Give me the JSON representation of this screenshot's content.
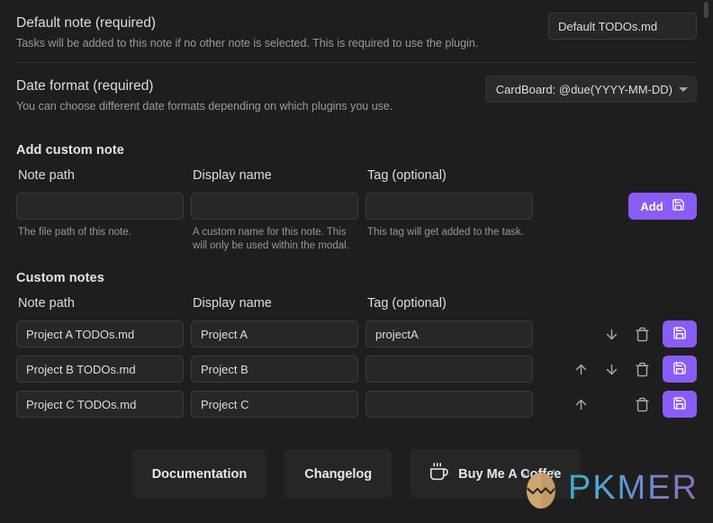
{
  "settings": [
    {
      "name": "Default note (required)",
      "desc": "Tasks will be added to this note if no other note is selected. This is required to use the plugin.",
      "control": "text",
      "value": "Default TODOs.md"
    },
    {
      "name": "Date format (required)",
      "desc": "You can choose different date formats depending on which plugins you use.",
      "control": "select",
      "value": "CardBoard: @due(YYYY-MM-DD)"
    }
  ],
  "add_section": {
    "title": "Add custom note",
    "columns": [
      "Note path",
      "Display name",
      "Tag (optional)"
    ],
    "fields": [
      {
        "value": "",
        "placeholder": "",
        "hint": "The file path of this note."
      },
      {
        "value": "",
        "placeholder": "",
        "hint": "A custom name for this note. This will only be used within the modal."
      },
      {
        "value": "",
        "placeholder": "",
        "hint": "This tag will get added to the task."
      }
    ],
    "add_label": "Add",
    "add_icon": "save-icon"
  },
  "custom_section": {
    "title": "Custom notes",
    "columns": [
      "Note path",
      "Display name",
      "Tag (optional)"
    ],
    "rows": [
      {
        "path": "Project A TODOs.md",
        "display": "Project A",
        "tag": "projectA",
        "has_up": false,
        "has_down": true
      },
      {
        "path": "Project B TODOs.md",
        "display": "Project B",
        "tag": "",
        "has_up": true,
        "has_down": true
      },
      {
        "path": "Project C TODOs.md",
        "display": "Project C",
        "tag": "",
        "has_up": true,
        "has_down": false
      }
    ],
    "icons": {
      "up": "arrow-up-icon",
      "down": "arrow-down-icon",
      "delete": "trash-icon",
      "save": "save-icon"
    }
  },
  "footer": {
    "documentation": "Documentation",
    "changelog": "Changelog",
    "coffee": "Buy Me A Coffee",
    "coffee_icon": "coffee-cup-icon"
  },
  "watermark": {
    "text": "PKMER",
    "icon": "pkmer-egg-icon"
  },
  "colors": {
    "background": "#1e1e1e",
    "accent": "#8a5cf6",
    "input_bg": "#272727",
    "text": "#dcddde",
    "muted_text": "#999a9c",
    "divider": "#333436"
  }
}
